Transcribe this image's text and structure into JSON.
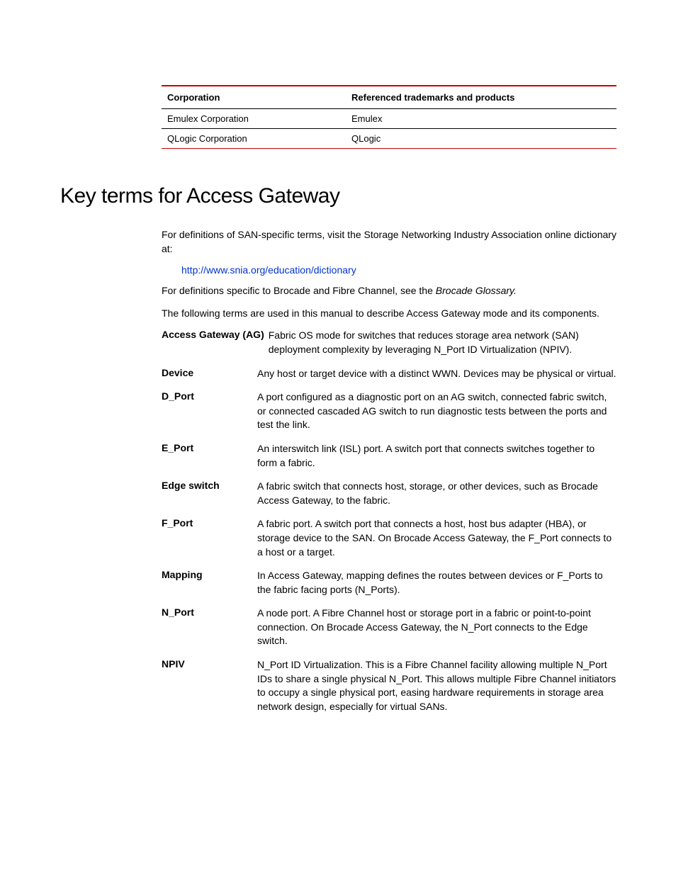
{
  "trademark_table": {
    "header_corporation": "Corporation",
    "header_products": "Referenced trademarks and products",
    "rows": [
      {
        "corporation": "Emulex Corporation",
        "products": "Emulex"
      },
      {
        "corporation": "QLogic Corporation",
        "products": "QLogic"
      }
    ]
  },
  "section_heading": "Key terms for Access Gateway",
  "intro_para": "For definitions of SAN-specific terms, visit the Storage Networking Industry Association online dictionary at:",
  "link_text": "http://www.snia.org/education/dictionary",
  "brocade_para_prefix": "For definitions specific to Brocade and Fibre Channel, see the ",
  "brocade_glossary_italic": "Brocade Glossary.",
  "following_terms_para": "The following terms are used in this manual to describe Access Gateway mode and its components.",
  "definitions": [
    {
      "term": "Access Gateway (AG)",
      "desc": "Fabric OS mode for switches that reduces storage area network (SAN) deployment complexity by leveraging N_Port ID Virtualization (NPIV)."
    },
    {
      "term": "Device",
      "desc": "Any host or target device with a distinct WWN. Devices may be physical or virtual."
    },
    {
      "term": "D_Port",
      "desc": "A port configured as a diagnostic port on an AG switch, connected fabric switch, or connected cascaded AG switch to run diagnostic tests between the ports and test the link."
    },
    {
      "term": "E_Port",
      "desc": "An interswitch link (ISL) port. A switch port that connects switches together to form a fabric."
    },
    {
      "term": "Edge switch",
      "desc": "A fabric switch that connects host, storage, or other devices, such as Brocade Access Gateway, to the fabric."
    },
    {
      "term": "F_Port",
      "desc": "A fabric port. A switch port that connects a host, host bus adapter (HBA), or storage device to the SAN. On Brocade Access Gateway, the F_Port connects to a host or a target."
    },
    {
      "term": "Mapping",
      "desc": "In Access Gateway, mapping defines the routes between devices or F_Ports to the fabric facing ports (N_Ports)."
    },
    {
      "term": "N_Port",
      "desc": "A node port. A Fibre Channel host or storage port in a fabric or point-to-point connection. On Brocade Access Gateway, the N_Port connects to the Edge switch."
    },
    {
      "term": "NPIV",
      "desc": "N_Port ID Virtualization. This is a Fibre Channel facility allowing multiple N_Port IDs to share a single physical N_Port. This allows multiple Fibre Channel initiators to occupy a single physical port, easing hardware requirements in storage area network design, especially for virtual SANs."
    }
  ]
}
